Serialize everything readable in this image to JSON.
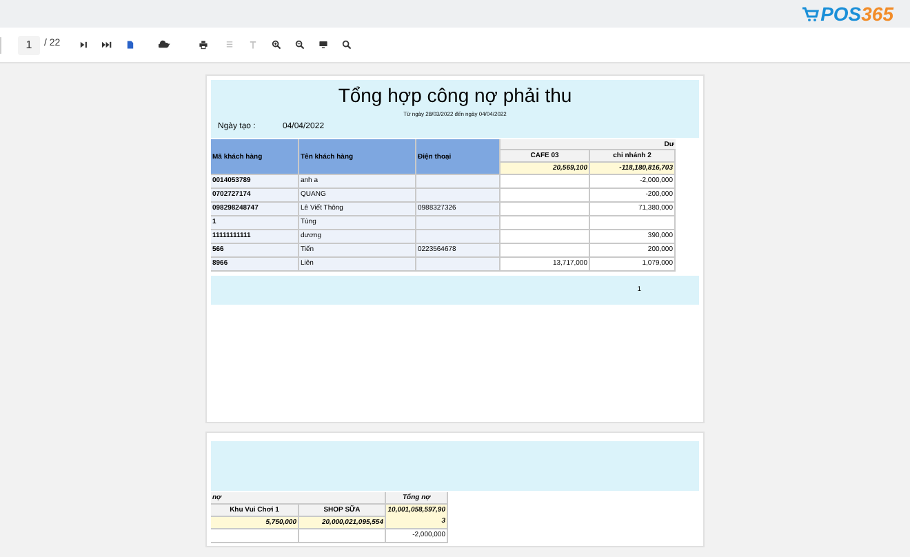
{
  "brand": {
    "logo": "POS365"
  },
  "toolbar": {
    "page": "1",
    "page_total": "/ 22",
    "buttons": [
      {
        "kind": "next",
        "disabled": false
      },
      {
        "kind": "last",
        "disabled": false
      },
      {
        "kind": "export",
        "disabled": false
      },
      {
        "kind": "download",
        "disabled": false
      },
      {
        "kind": "print",
        "disabled": false
      },
      {
        "kind": "layout",
        "disabled": true
      },
      {
        "kind": "text",
        "disabled": true
      },
      {
        "kind": "zoom-in",
        "disabled": false
      },
      {
        "kind": "zoom-out",
        "disabled": false
      },
      {
        "kind": "screen",
        "disabled": false
      },
      {
        "kind": "search",
        "disabled": false
      }
    ]
  },
  "page_1": {
    "title": "Tổng hợp công nợ phải thu",
    "subtitle": "Từ ngày 28/03/2022 đến ngày 04/04/2022",
    "created_label": "Ngày tạo :",
    "created_value": "04/04/2022",
    "columns": [
      "Mã khách hàng",
      "Tên khách hàng",
      "Điện thoại"
    ],
    "group_header": "Dư",
    "branch_columns": [
      "CAFE 03",
      "chi nhánh 2"
    ],
    "totals": [
      "20,569,100",
      "-118,180,816,703"
    ],
    "rows": [
      {
        "code": "0014053789",
        "name": "anh a",
        "chi_nhanh_2": "-2,000,000"
      },
      {
        "code": "0702727174",
        "name": "QUANG",
        "chi_nhanh_2": "-200,000"
      },
      {
        "code": "098298248747",
        "name": "Lê Viết Thông",
        "phone": "0988327326",
        "chi_nhanh_2": "71,380,000"
      },
      {
        "code": "1",
        "name": "Tùng"
      },
      {
        "code": "11111111111",
        "name": "dương",
        "chi_nhanh_2": "390,000"
      },
      {
        "code": "566",
        "name": "Tiến",
        "phone": "0223564678",
        "chi_nhanh_2": "200,000"
      },
      {
        "code": "8966",
        "name": "Liên",
        "cafe_03": "13,717,000",
        "chi_nhanh_2": "1,079,000"
      }
    ],
    "page_number": "1"
  },
  "page_2": {
    "group_header": "nợ",
    "branch_columns": [
      "Khu Vui Chơi 1",
      "SHOP SỮA"
    ],
    "total_column": "Tổng nợ",
    "totals": [
      "5,750,000",
      "20,000,021,095,554",
      "10,001,058,597,903"
    ],
    "rows": [
      {
        "tong_no": "-2,000,000"
      }
    ]
  }
}
